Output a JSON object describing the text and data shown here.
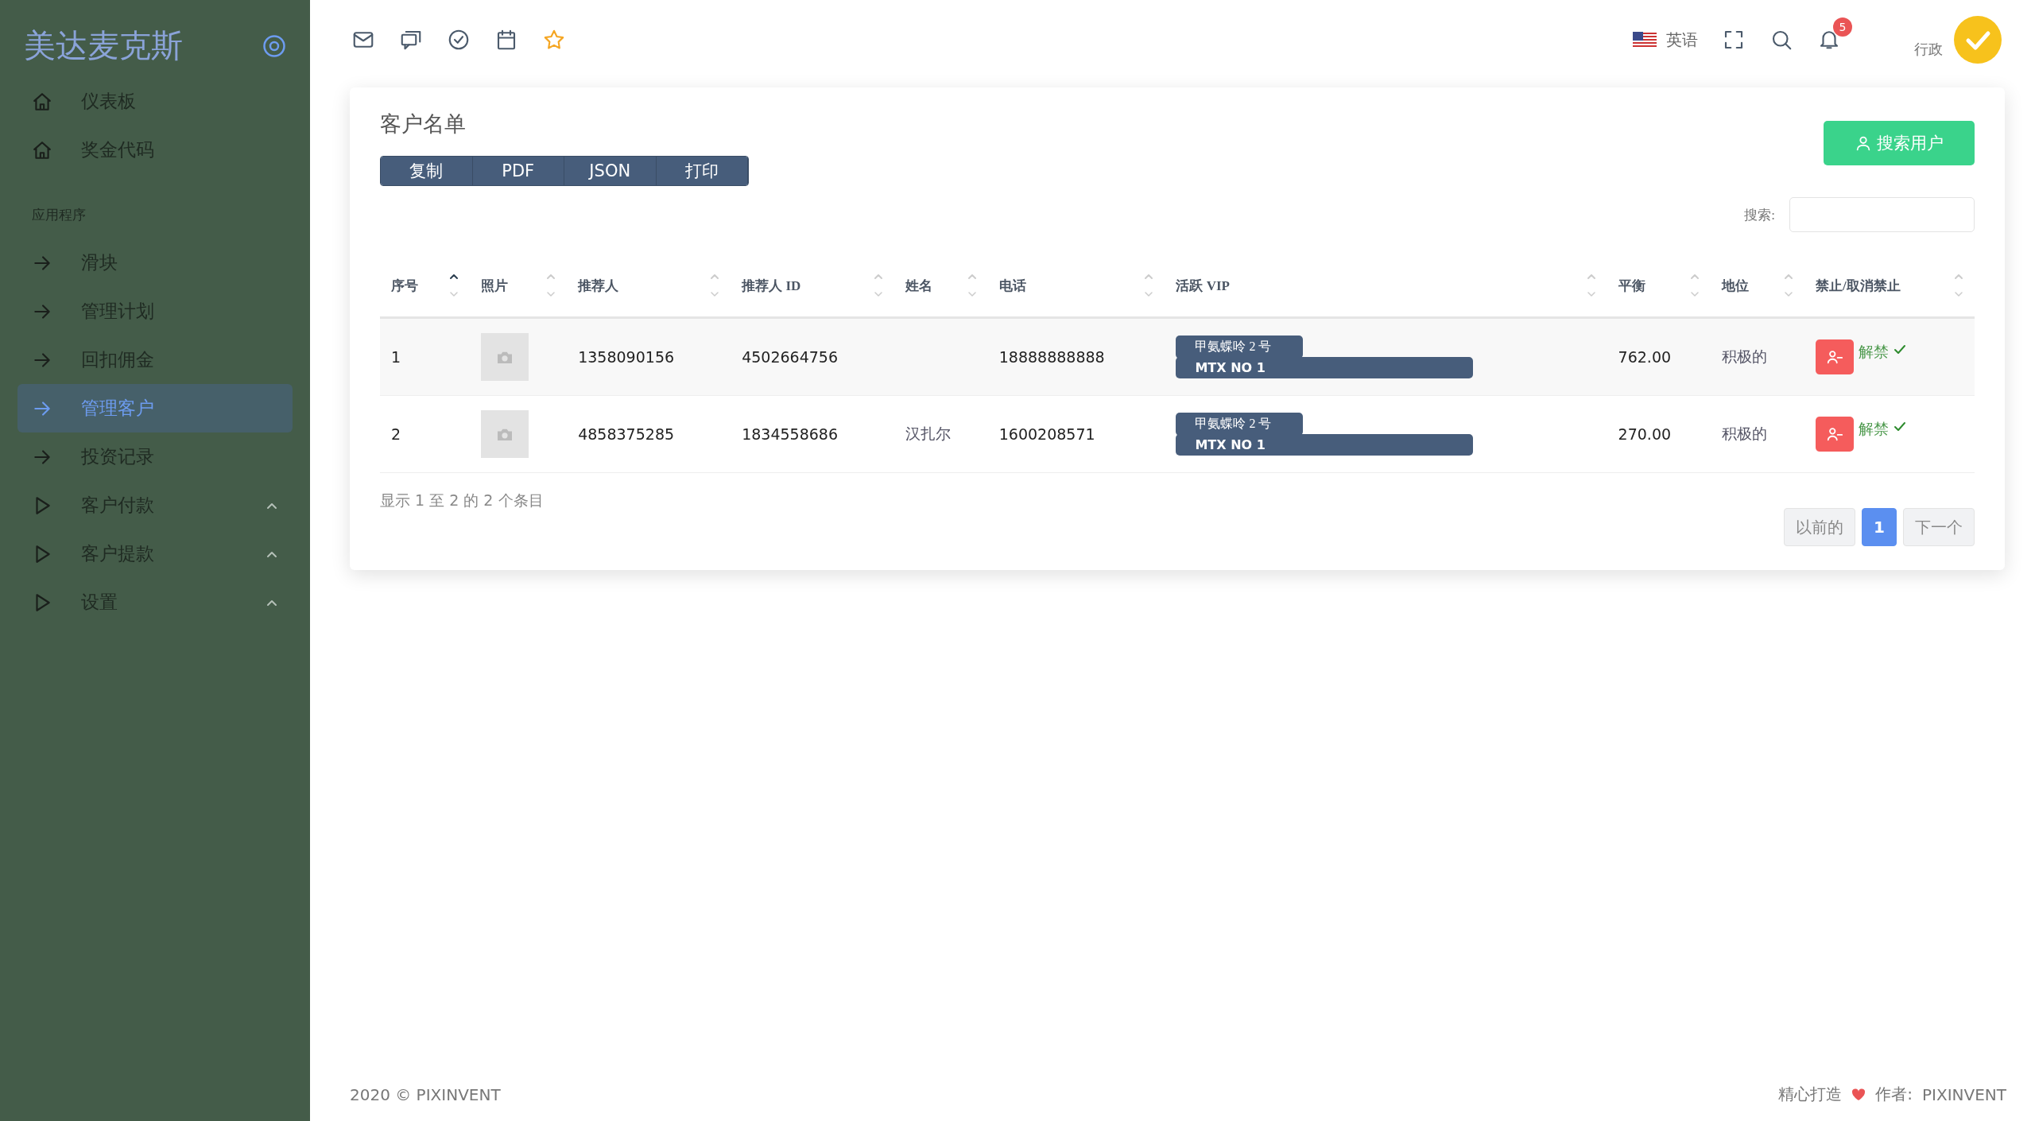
{
  "sidebar": {
    "brand": "美达麦克斯",
    "items": [
      {
        "kind": "home",
        "label": "仪表板",
        "selected": false
      },
      {
        "kind": "home",
        "label": "奖金代码",
        "selected": false
      },
      {
        "kind": "section",
        "label": "应用程序"
      },
      {
        "kind": "arrow",
        "label": "滑块",
        "selected": false
      },
      {
        "kind": "arrow",
        "label": "管理计划",
        "selected": false
      },
      {
        "kind": "arrow",
        "label": "回扣佣金",
        "selected": false
      },
      {
        "kind": "arrow",
        "label": "管理客户",
        "selected": true
      },
      {
        "kind": "arrow",
        "label": "投资记录",
        "selected": false
      },
      {
        "kind": "group",
        "label": "客户付款",
        "selected": false
      },
      {
        "kind": "group",
        "label": "客户提款",
        "selected": false
      },
      {
        "kind": "group",
        "label": "设置",
        "selected": false
      }
    ]
  },
  "header": {
    "language": "英语",
    "notification_count": "5",
    "user_role": "行政"
  },
  "card": {
    "title": "客户名单",
    "export_buttons": [
      "复制",
      "PDF",
      "JSON",
      "打印"
    ],
    "search_user_button": "搜索用户",
    "search_label": "搜索:"
  },
  "table": {
    "columns": [
      {
        "label": "序号",
        "sorted": true
      },
      {
        "label": "照片",
        "sorted": false
      },
      {
        "label": "推荐人",
        "sorted": false
      },
      {
        "label": "推荐人 ID",
        "sorted": false
      },
      {
        "label": "姓名",
        "sorted": false
      },
      {
        "label": "电话",
        "sorted": false
      },
      {
        "label": "活跃 VIP",
        "sorted": false
      },
      {
        "label": "平衡",
        "sorted": false
      },
      {
        "label": "地位",
        "sorted": false
      },
      {
        "label": "禁止/取消禁止",
        "sorted": false
      }
    ],
    "rows": [
      {
        "index": "1",
        "referrer": "1358090156",
        "referrer_id": "4502664756",
        "phone": "18888888888",
        "vip": [
          "甲氨蝶呤 2 号",
          "MTX NO 1"
        ],
        "balance": "762.00",
        "status": "积极的",
        "unban": "解禁"
      },
      {
        "index": "2",
        "referrer": "4858375285",
        "referrer_id": "1834558686",
        "name": "汉扎尔",
        "phone": "1600208571",
        "vip": [
          "甲氨蝶呤 2 号",
          "MTX NO 1"
        ],
        "balance": "270.00",
        "status": "积极的",
        "unban": "解禁"
      }
    ]
  },
  "table_info": "显示 1 至 2 的 2 个条目",
  "pagination": [
    {
      "label": "以前的",
      "selected": false
    },
    {
      "label": "1",
      "selected": true
    },
    {
      "label": "下一个",
      "selected": false
    }
  ],
  "footer": {
    "copyright": "2020 © PIXINVENT",
    "made_with": "精心打造",
    "author_label": "作者:",
    "author": "PIXINVENT"
  }
}
